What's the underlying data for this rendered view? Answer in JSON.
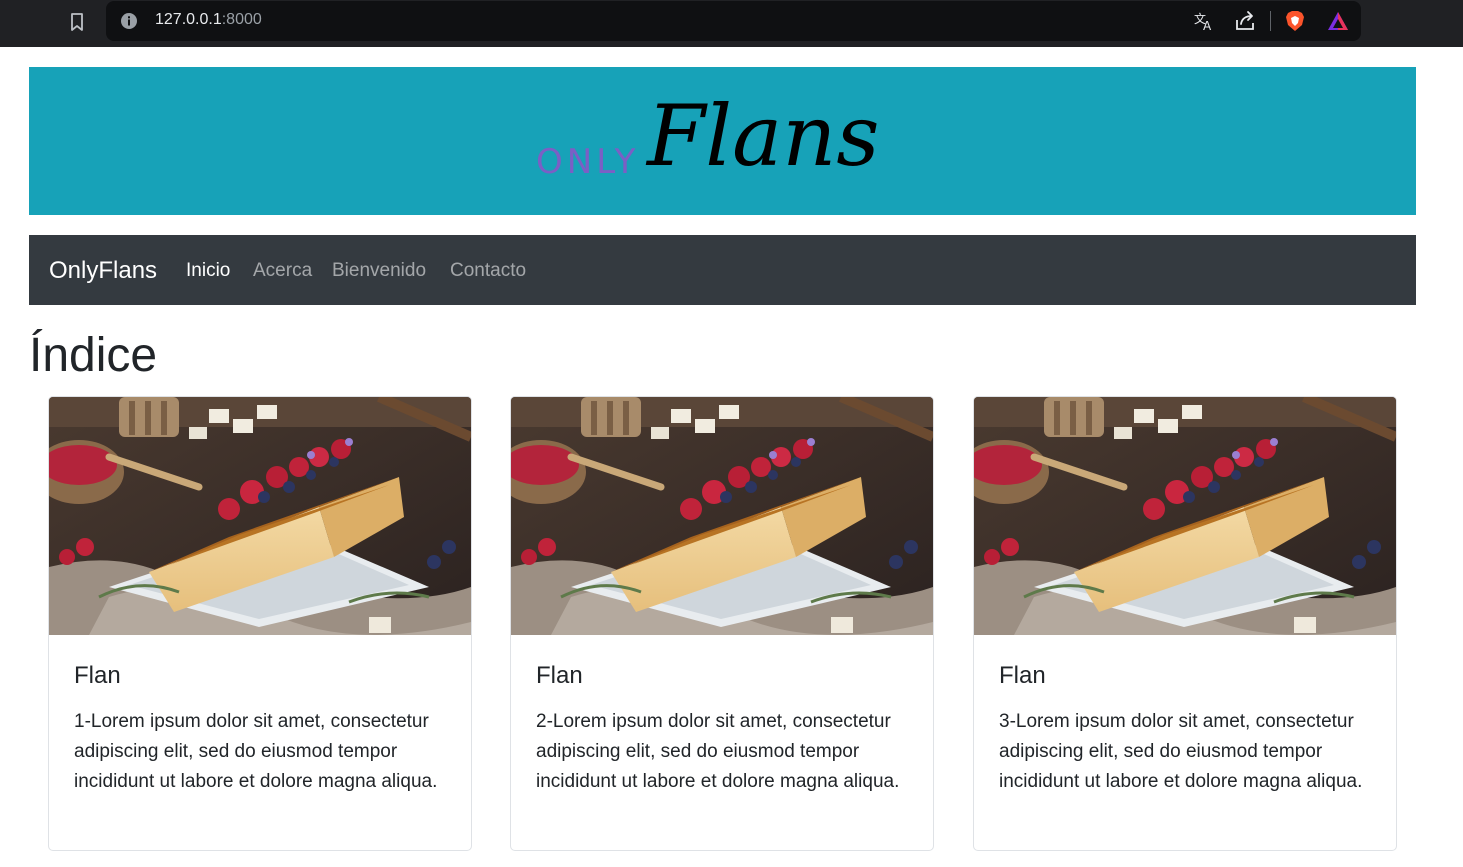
{
  "browser": {
    "url_host": "127.0.0.1",
    "url_port": ":8000",
    "icons": [
      "bookmark-icon",
      "info-icon",
      "translate-icon",
      "share-icon",
      "brave-shield-icon",
      "brave-rewards-icon"
    ]
  },
  "banner": {
    "logo_only": "ONLY",
    "logo_flans": "Flans",
    "colors": {
      "background": "#17a2b8",
      "only": "#7b5fc5",
      "flans": "#000000"
    }
  },
  "navbar": {
    "brand": "OnlyFlans",
    "links": [
      {
        "label": "Inicio",
        "active": true
      },
      {
        "label": "Acerca",
        "active": false
      },
      {
        "label": "Bienvenido",
        "active": false
      },
      {
        "label": "Contacto",
        "active": false
      }
    ],
    "colors": {
      "background": "#343a40"
    }
  },
  "main": {
    "title": "Índice",
    "cards": [
      {
        "title": "Flan",
        "text": "1-Lorem ipsum dolor sit amet, consectetur adipiscing elit, sed do eiusmod tempor incididunt ut labore et dolore magna aliqua."
      },
      {
        "title": "Flan",
        "text": "2-Lorem ipsum dolor sit amet, consectetur adipiscing elit, sed do eiusmod tempor incididunt ut labore et dolore magna aliqua."
      },
      {
        "title": "Flan",
        "text": "3-Lorem ipsum dolor sit amet, consectetur adipiscing elit, sed do eiusmod tempor incididunt ut labore et dolore magna aliqua."
      }
    ]
  }
}
